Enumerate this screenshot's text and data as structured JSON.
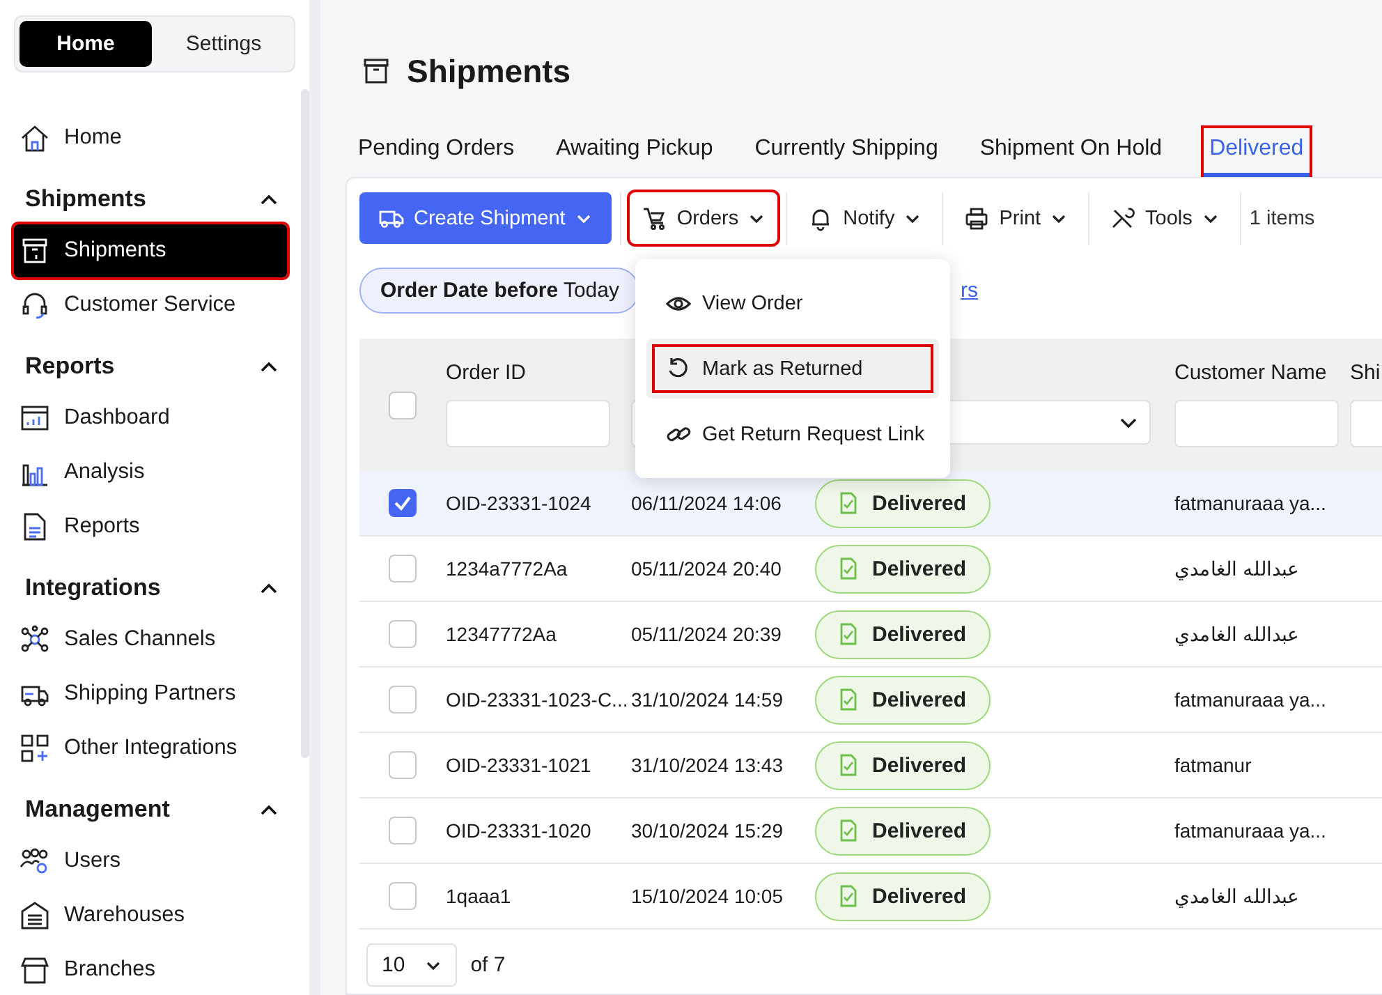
{
  "mode_switch": [
    {
      "label": "Home",
      "selected": true
    },
    {
      "label": "Settings",
      "selected": false
    }
  ],
  "sidebar": {
    "sections": [
      {
        "items": [
          {
            "label": "Home",
            "selected": false,
            "highlighted": false
          }
        ]
      },
      {
        "title": "Shipments",
        "expanded": true,
        "items": [
          {
            "label": "Shipments",
            "selected": true,
            "highlighted": true
          },
          {
            "label": "Customer Service",
            "selected": false,
            "highlighted": false
          }
        ]
      },
      {
        "title": "Reports",
        "expanded": true,
        "items": [
          {
            "label": "Dashboard",
            "selected": false,
            "highlighted": false
          },
          {
            "label": "Analysis",
            "selected": false,
            "highlighted": false
          },
          {
            "label": "Reports",
            "selected": false,
            "highlighted": false
          }
        ]
      },
      {
        "title": "Integrations",
        "expanded": true,
        "items": [
          {
            "label": "Sales Channels",
            "selected": false,
            "highlighted": false
          },
          {
            "label": "Shipping Partners",
            "selected": false,
            "highlighted": false
          },
          {
            "label": "Other Integrations",
            "selected": false,
            "highlighted": false
          }
        ]
      },
      {
        "title": "Management",
        "expanded": true,
        "items": [
          {
            "label": "Users",
            "selected": false,
            "highlighted": false
          },
          {
            "label": "Warehouses",
            "selected": false,
            "highlighted": false
          },
          {
            "label": "Branches",
            "selected": false,
            "highlighted": false
          }
        ]
      }
    ]
  },
  "page_title": "Shipments",
  "tabs": [
    {
      "label": "Pending Orders",
      "selected": false,
      "highlighted": false
    },
    {
      "label": "Awaiting Pickup",
      "selected": false,
      "highlighted": false
    },
    {
      "label": "Currently Shipping",
      "selected": false,
      "highlighted": false
    },
    {
      "label": "Shipment On Hold",
      "selected": false,
      "highlighted": false
    },
    {
      "label": "Delivered",
      "selected": true,
      "highlighted": true
    }
  ],
  "toolbar": {
    "buttons": [
      {
        "kind": "primary",
        "label": "Create Shipment",
        "highlighted": false
      },
      {
        "kind": "menu",
        "label": "Orders",
        "highlighted": true
      },
      {
        "kind": "menu",
        "label": "Notify",
        "highlighted": false
      },
      {
        "kind": "menu",
        "label": "Print",
        "highlighted": false
      },
      {
        "kind": "menu",
        "label": "Tools",
        "highlighted": false
      }
    ],
    "item_count": "1 items"
  },
  "filters": {
    "chip": "**Order Date before** Today",
    "link": "rs"
  },
  "orders_menu": {
    "items": [
      {
        "label": "View Order",
        "hovered": false,
        "highlighted": false
      },
      {
        "label": "Mark as Returned",
        "hovered": true,
        "highlighted": true
      },
      {
        "label": "Get Return Request Link",
        "hovered": false,
        "highlighted": false
      }
    ]
  },
  "table": {
    "header_checked": false,
    "columns": [
      {
        "label": "Order ID",
        "kind": "text"
      },
      {
        "kind": "text"
      },
      {
        "kind": "select"
      },
      {
        "label": "Customer Name",
        "kind": "text"
      },
      {
        "label": "Shi",
        "kind": "text"
      }
    ],
    "rows": [
      {
        "selected": true,
        "order_id": "OID-23331-1024",
        "date": "06/11/2024 14:06",
        "status": "Delivered",
        "customer": "fatmanuraaa ya..."
      },
      {
        "selected": false,
        "order_id": "1234a7772Aa",
        "date": "05/11/2024 20:40",
        "status": "Delivered",
        "customer": "عبدالله الغامدي"
      },
      {
        "selected": false,
        "order_id": "12347772Aa",
        "date": "05/11/2024 20:39",
        "status": "Delivered",
        "customer": "عبدالله الغامدي"
      },
      {
        "selected": false,
        "order_id": "OID-23331-1023-C...",
        "date": "31/10/2024 14:59",
        "status": "Delivered",
        "customer": "fatmanuraaa ya..."
      },
      {
        "selected": false,
        "order_id": "OID-23331-1021",
        "date": "31/10/2024 13:43",
        "status": "Delivered",
        "customer": "fatmanur"
      },
      {
        "selected": false,
        "order_id": "OID-23331-1020",
        "date": "30/10/2024 15:29",
        "status": "Delivered",
        "customer": "fatmanuraaa ya..."
      },
      {
        "selected": false,
        "order_id": "1qaaa1",
        "date": "15/10/2024 10:05",
        "status": "Delivered",
        "customer": "عبدالله الغامدي"
      }
    ]
  },
  "pagination": {
    "page_size": "10",
    "total": "of 7"
  }
}
